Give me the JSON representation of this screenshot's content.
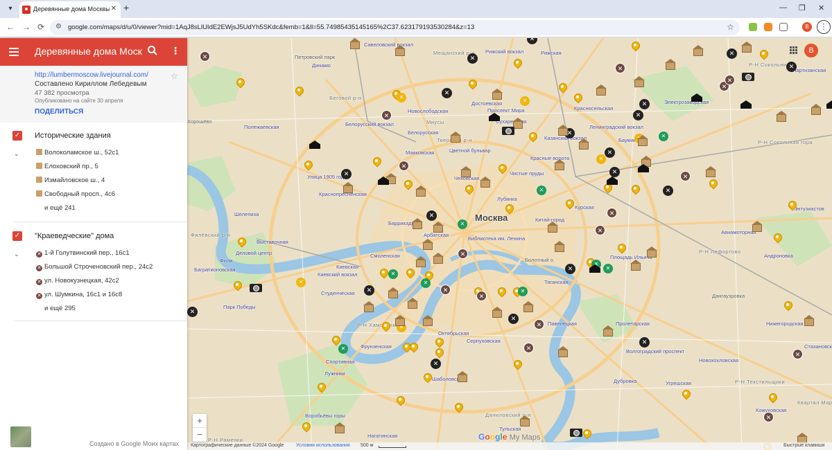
{
  "browser": {
    "tab_title": "Деревянные дома Москвы (G…",
    "url": "google.com/maps/d/u/0/viewer?mid=1AqJ8sLlUIdE2EWjsJ5UdYh5SKdc&femb=1&ll=55.74985435145165%2C37.623179193530284&z=13",
    "profile_letter": "B"
  },
  "panel": {
    "title": "Деревянные дома Москв…",
    "link": "http://lumbermoscow.livejournal.com/",
    "author": "Составлено Кириллом Лебедевым",
    "views": "47 382 просмотра",
    "published": "Опубликовано на сайте 30 апреля",
    "share": "ПОДЕЛИТЬСЯ",
    "layers": [
      {
        "title": "Исторические здания",
        "items": [
          "Волоколамское ш., 52с1",
          "Елоховский пр., 5",
          "Измайловское ш., 4",
          "Свободный просп., 4с6"
        ],
        "more": "и ещё 241"
      },
      {
        "title": "\"Краеведческие\" дома",
        "items": [
          "1-й Голутвинский пер., 16с1",
          "Большой Строченовский пер., 24с2",
          "ул. Новокузнецкая, 42с2",
          "ул. Шумкина, 16с1 и 16с8"
        ],
        "more": "и ещё 295"
      }
    ],
    "footer": "Создано в Google Моих картах"
  },
  "map": {
    "city": "Москва",
    "labels": [
      "Петровский парк",
      "Динамо",
      "Савеловский вокзал",
      "Рижский вокзал",
      "Рижская",
      "Беговой р-н",
      "Новослободская",
      "Достоевская",
      "Проспект Мира",
      "Красносельская",
      "Хорошёво",
      "Полежаевская",
      "Белорусский вокзал",
      "Миусы",
      "Белорусская",
      "Тверской р-н",
      "Цветной бульвар",
      "Сухаревская",
      "Казанский вокзал",
      "Ленинградский вокзал",
      "Маяковская",
      "Улица 1905 года",
      "Чеховская",
      "Чистые пруды",
      "Красные ворота",
      "Краснопресненская",
      "Лубянка",
      "Курская",
      "Шелепиха",
      "Китай-город",
      "Баррикадная",
      "Арбатская",
      "Библиотека им. Ленина",
      "Выставочная",
      "Деловой центр",
      "Смоленская",
      "Болотный о.",
      "Киевская",
      "Киевский вокзал",
      "Студенческая",
      "Таганская",
      "Парк Победы",
      "Павелецкая",
      "Октябрьская",
      "Серпуховская",
      "Фрунзенская",
      "Спортивная",
      "Лужники",
      "Шаболовская",
      "Даниловский р-н",
      "Тульская",
      "Нагатинская",
      "Воробьёвы горы",
      "Р-Н Раменки",
      "Р-Н Сокольники",
      "Р-Н Лефортово",
      "Р-Н Текстильщики",
      "Авиамоторная",
      "Андроновка",
      "Нижегородская",
      "Дангаузровка",
      "Пролетарская",
      "Волгоградский проспект",
      "Новохохловская",
      "Дубровка",
      "Угрешская",
      "Площадь Ильича",
      "Бауманская",
      "Электрозаводская",
      "Энтузиастов",
      "Р-Н Соколиная гора",
      "Партизанская",
      "Филёвский р-н",
      "Багратионовская",
      "Фили",
      "Стахановская",
      "Кожуховская",
      "Квартал Марьина роща",
      "Мещанский р-н",
      "Р-Н Хамовники"
    ],
    "zoom_in": "+",
    "zoom_out": "−",
    "attribution": "Картографические данные ©2024 Google",
    "terms": "Условия использования",
    "scale": "500 м",
    "shortcuts": "Быстрые клавиши",
    "logo": "Google My Maps"
  },
  "colors": {
    "header": "#db4437",
    "pin": "#f2b50b",
    "river": "#9bc6e4",
    "road_major": "#f6cf8f"
  }
}
